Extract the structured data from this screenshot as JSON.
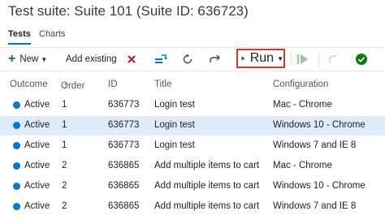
{
  "title": "Test suite: Suite 101 (Suite ID: 636723)",
  "tabs": [
    {
      "label": "Tests"
    },
    {
      "label": "Charts"
    }
  ],
  "toolbar": {
    "new_label": "New",
    "add_existing_label": "Add existing",
    "run_label": "Run"
  },
  "columns": {
    "outcome": "Outcome",
    "order": "Order",
    "id": "ID",
    "title": "Title",
    "configuration": "Configuration"
  },
  "rows": [
    {
      "outcome": "Active",
      "order": "1",
      "id": "636773",
      "title": "Login test",
      "configuration": "Mac - Chrome"
    },
    {
      "outcome": "Active",
      "order": "1",
      "id": "636773",
      "title": "Login test",
      "configuration": "Windows 10 - Chrome"
    },
    {
      "outcome": "Active",
      "order": "1",
      "id": "636773",
      "title": "Login test",
      "configuration": "Windows 7 and IE 8"
    },
    {
      "outcome": "Active",
      "order": "2",
      "id": "636865",
      "title": "Add multiple items to cart",
      "configuration": "Mac - Chrome"
    },
    {
      "outcome": "Active",
      "order": "2",
      "id": "636865",
      "title": "Add multiple items to cart",
      "configuration": "Windows 10 - Chrome"
    },
    {
      "outcome": "Active",
      "order": "2",
      "id": "636865",
      "title": "Add multiple items to cart",
      "configuration": "Windows 7 and IE 8"
    }
  ],
  "colors": {
    "accent": "#0078d4",
    "run_highlight": "#d83b1f",
    "selected_row": "#deecf9",
    "run_green": "#107c10"
  }
}
